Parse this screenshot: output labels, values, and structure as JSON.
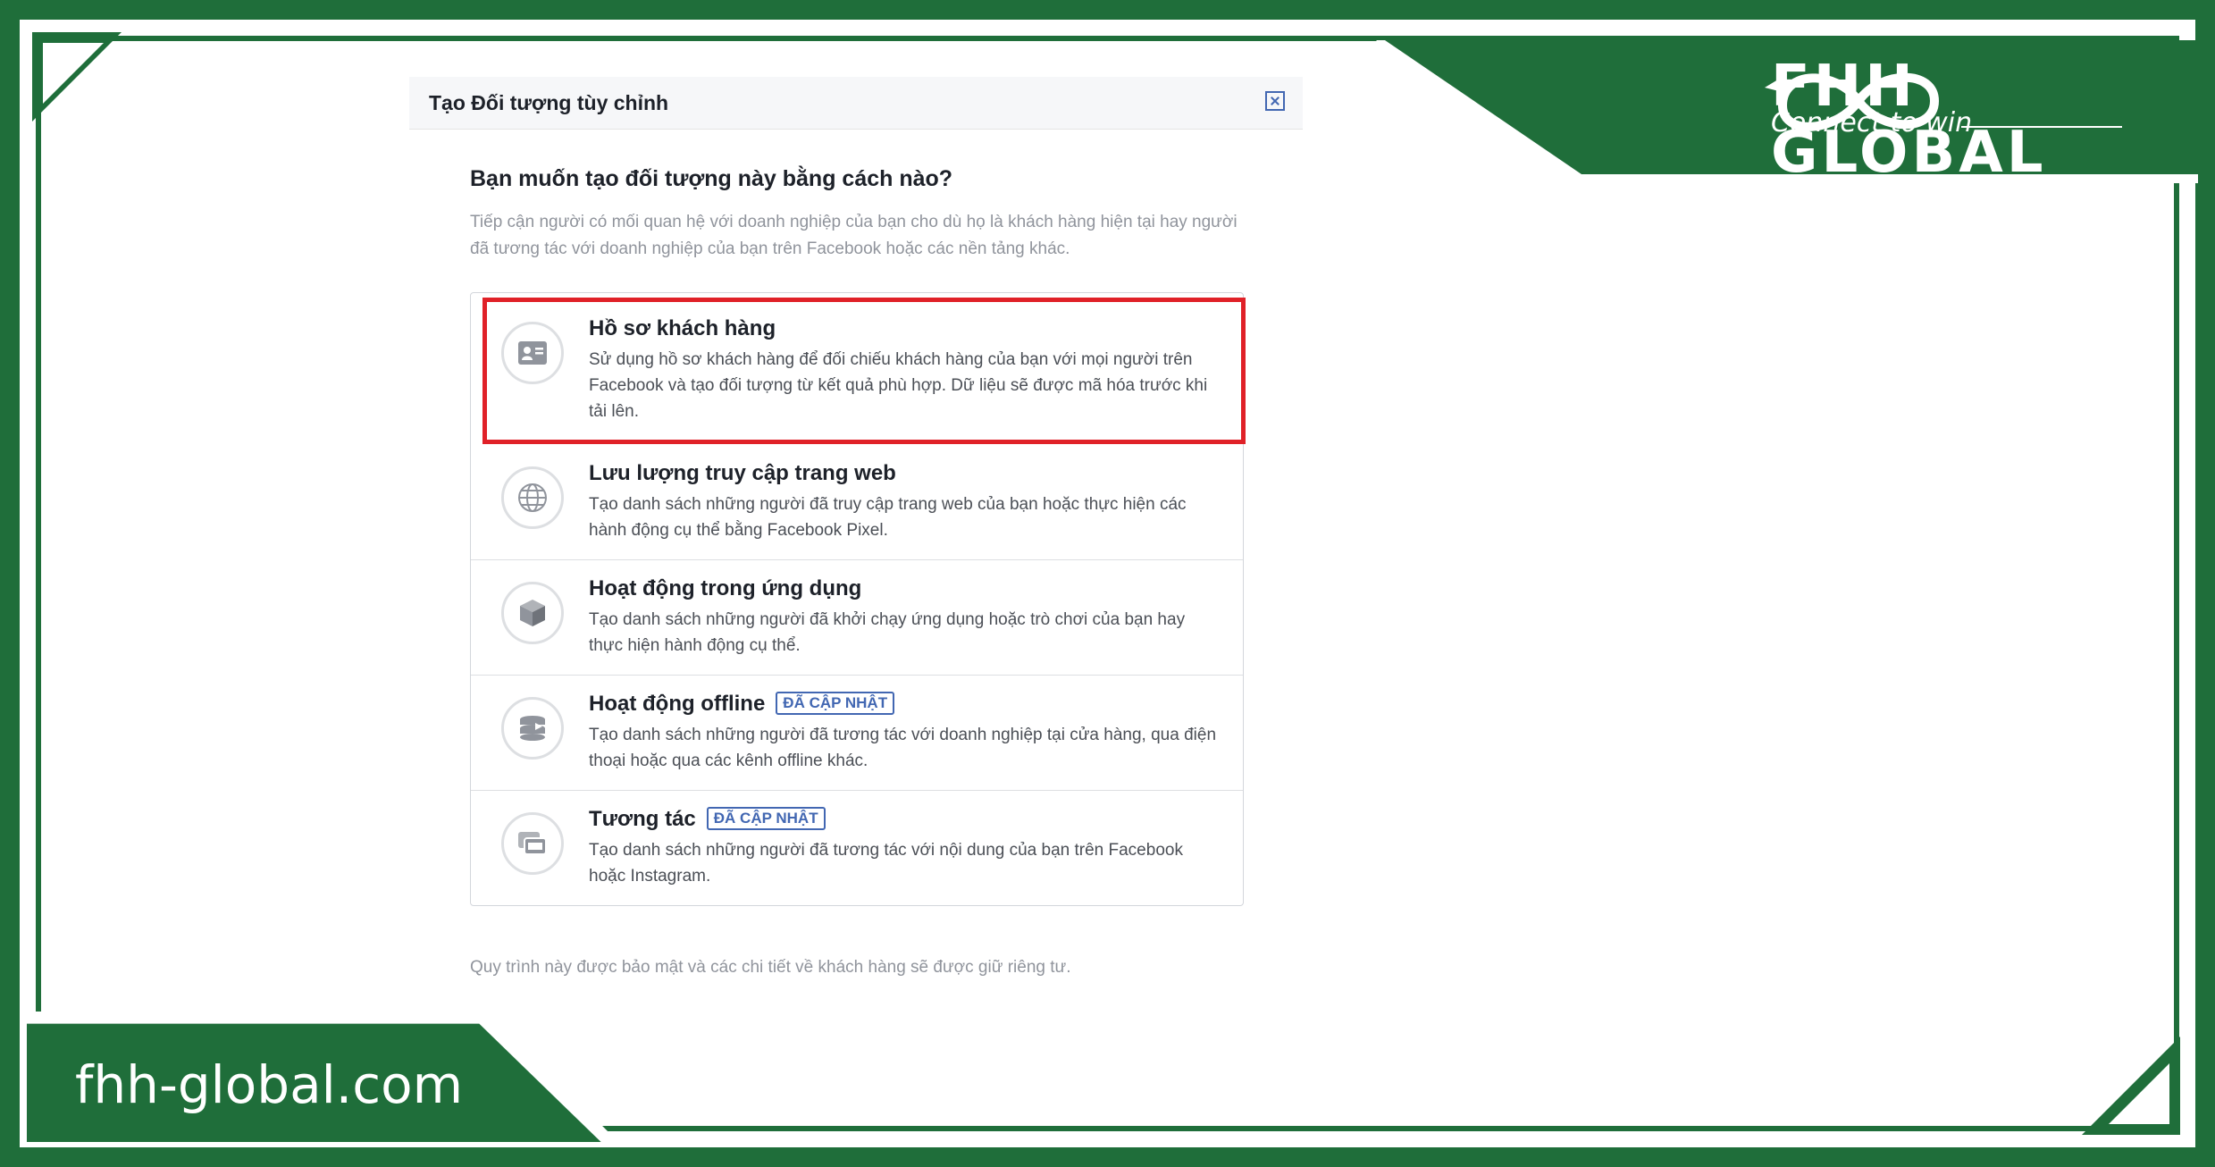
{
  "brand": {
    "name": "FHH GLOBAL",
    "slogan": "Connect to win",
    "site": "fhh-global.com"
  },
  "dialog": {
    "title": "Tạo Đối tượng tùy chỉnh",
    "question": "Bạn muốn tạo đối tượng này bằng cách nào?",
    "description": "Tiếp cận người có mối quan hệ với doanh nghiệp của bạn cho dù họ là khách hàng hiện tại hay người đã tương tác với doanh nghiệp của bạn trên Facebook hoặc các nền tảng khác.",
    "options": [
      {
        "title": "Hồ sơ khách hàng",
        "desc": "Sử dụng hồ sơ khách hàng để đối chiếu khách hàng của bạn với mọi người trên Facebook và tạo đối tượng từ kết quả phù hợp. Dữ liệu sẽ được mã hóa trước khi tải lên.",
        "badge": "",
        "icon": "contact-card-icon"
      },
      {
        "title": "Lưu lượng truy cập trang web",
        "desc": "Tạo danh sách những người đã truy cập trang web của bạn hoặc thực hiện các hành động cụ thể bằng Facebook Pixel.",
        "badge": "",
        "icon": "globe-icon"
      },
      {
        "title": "Hoạt động trong ứng dụng",
        "desc": "Tạo danh sách những người đã khởi chạy ứng dụng hoặc trò chơi của bạn hay thực hiện hành động cụ thể.",
        "badge": "",
        "icon": "cube-icon"
      },
      {
        "title": "Hoạt động offline",
        "desc": "Tạo danh sách những người đã tương tác với doanh nghiệp tại cửa hàng, qua điện thoại hoặc qua các kênh offline khác.",
        "badge": "ĐÃ CẬP NHẬT",
        "icon": "offline-stack-icon"
      },
      {
        "title": "Tương tác",
        "desc": "Tạo danh sách những người đã tương tác với nội dung của bạn trên Facebook hoặc Instagram.",
        "badge": "ĐÃ CẬP NHẬT",
        "icon": "engagement-cards-icon"
      }
    ],
    "footnote": "Quy trình này được bảo mật và các chi tiết về khách hàng sẽ được giữ riêng tư."
  },
  "colors": {
    "brand_green": "#1f6e3a",
    "highlight_red": "#e02128",
    "fb_blue": "#4267b2"
  }
}
